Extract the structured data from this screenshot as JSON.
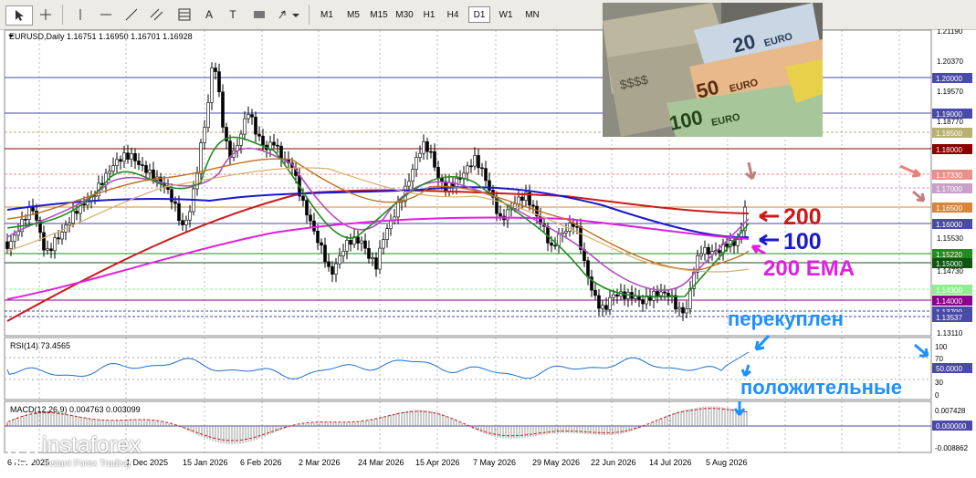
{
  "toolbar": {
    "timeframes": [
      "M1",
      "M5",
      "M15",
      "M30",
      "H1",
      "H4",
      "D1",
      "W1",
      "MN"
    ],
    "active_timeframe": "D1",
    "text_tool": "A",
    "label_tool": "T"
  },
  "chart": {
    "symbol_info": "EURUSD,Daily  1.16751 1.16950 1.16701 1.16928",
    "price_labels": [
      "1.21190",
      "1.20370",
      "1.19570",
      "1.18770",
      "1.17330",
      "1.16530",
      "1.15530",
      "1.14730",
      "1.13110"
    ],
    "level_labels": [
      {
        "text": "1.20000",
        "color": "#4a4aa8"
      },
      {
        "text": "1.19000",
        "color": "#4a4aa8"
      },
      {
        "text": "1.18500",
        "color": "#b8b070"
      },
      {
        "text": "1.18000",
        "color": "#8b0000"
      },
      {
        "text": "1.17330",
        "color": "#e8908a"
      },
      {
        "text": "1.17000",
        "color": "#c8a0c8"
      },
      {
        "text": "1.16500",
        "color": "#d8863a"
      },
      {
        "text": "1.16000",
        "color": "#4a4aa8"
      },
      {
        "text": "1.15220",
        "color": "#228b22"
      },
      {
        "text": "1.15000",
        "color": "#115511"
      },
      {
        "text": "1.14300",
        "color": "#90ee90"
      },
      {
        "text": "1.14000",
        "color": "#8b008b"
      },
      {
        "text": "1.13700",
        "color": "#4a4aa8"
      },
      {
        "text": "1.13537",
        "color": "#4a4aa8"
      }
    ],
    "date_labels": [
      "6 Nov 2025",
      "1 Dec 2025",
      "15 Jan 2026",
      "6 Feb 2026",
      "2 Mar 2026",
      "24 Mar 2026",
      "15 Apr 2026",
      "7 May 2026",
      "29 May 2026",
      "22 Jun 2026",
      "14 Jul 2026",
      "5 Aug 2026"
    ],
    "annotations": {
      "ma200": "200",
      "ma100": "100",
      "ema200": "200 EMA",
      "overbought": "перекуплен",
      "positive": "положительные"
    },
    "colors": {
      "ma200": "#cc1a1a",
      "ma100": "#1a1acc",
      "ema200": "#e020e0",
      "annotation_blue": "#1e90ff"
    }
  },
  "rsi": {
    "title": "RSI(14) 73.4565",
    "labels": [
      "100",
      "70",
      "50.0000",
      "30",
      "0"
    ]
  },
  "macd": {
    "title": "MACD(12,26,9) 0.004763 0.003099",
    "labels": [
      "0.007428",
      "0.000000",
      "-0.008862"
    ]
  },
  "logo": {
    "name": "instaforex",
    "tagline": "Instant Forex Trading"
  }
}
